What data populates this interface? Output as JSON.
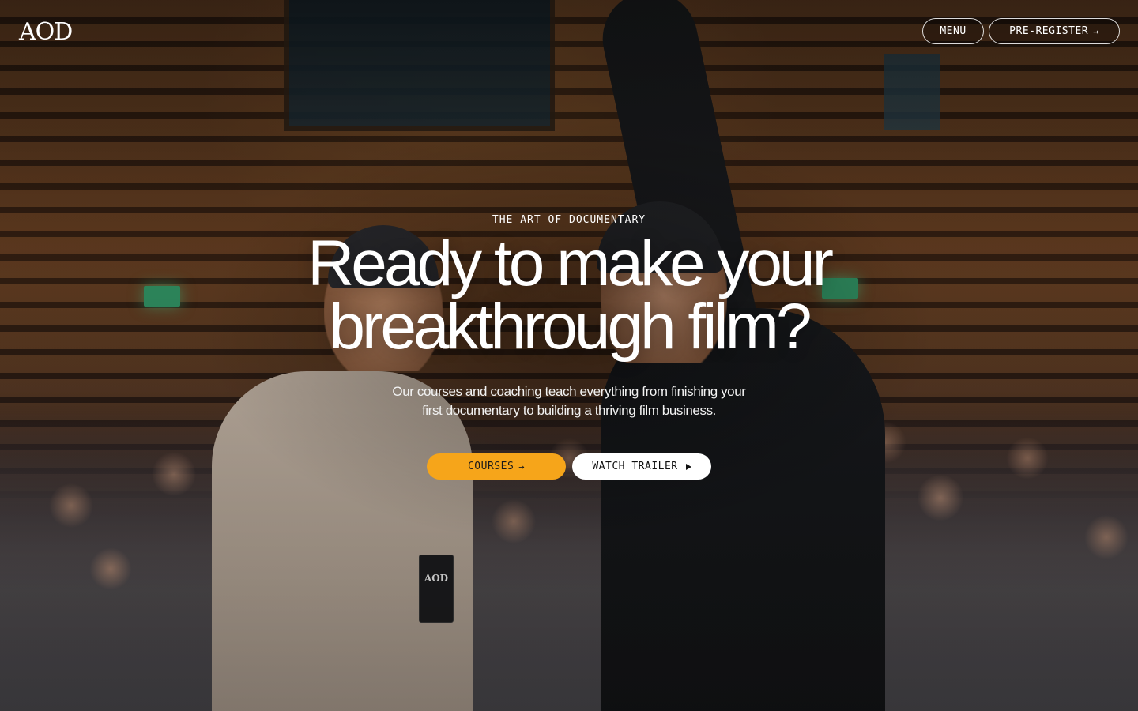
{
  "brand": {
    "logo_text": "AOD"
  },
  "nav": {
    "menu_label": "MENU",
    "preregister_label": "PRE-REGISTER",
    "preregister_arrow": "→"
  },
  "hero": {
    "eyebrow": "THE ART OF DOCUMENTARY",
    "headline": "Ready to make your breakthrough film?",
    "subtitle": "Our courses and coaching teach everything from finishing your first documentary to building a thriving film business.",
    "primary_cta": {
      "label": "COURSES",
      "arrow": "→",
      "color": "#f6a51a"
    },
    "secondary_cta": {
      "label": "WATCH TRAILER",
      "icon": "play-icon"
    }
  }
}
